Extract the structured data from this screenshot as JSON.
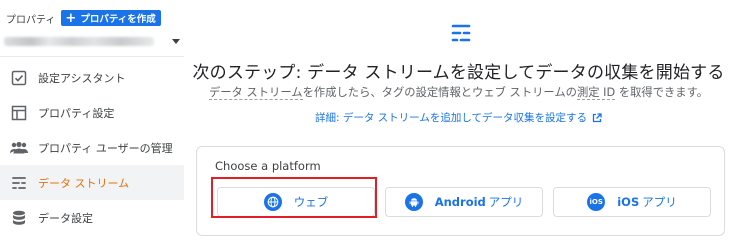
{
  "sidebar": {
    "property_label": "プロパティ",
    "create_button": "プロパティを作成",
    "items": [
      {
        "label": "設定アシスタント",
        "icon": "checklist-icon"
      },
      {
        "label": "プロパティ設定",
        "icon": "layout-icon"
      },
      {
        "label": "プロパティ ユーザーの管理",
        "icon": "people-icon"
      },
      {
        "label": "データ ストリーム",
        "icon": "stream-icon",
        "active": true
      },
      {
        "label": "データ設定",
        "icon": "database-icon"
      }
    ]
  },
  "main": {
    "headline": "次のステップ: データ ストリームを設定してデータの収集を開始する",
    "subline": {
      "part1": "データ ストリーム",
      "part2": "を作成したら、タグの設定情報とウェブ ストリームの",
      "part3": "測定 ID",
      "part4": " を取得できます。"
    },
    "learn_link": "詳細: データ ストリームを追加してデータ収集を設定する",
    "platform_card": {
      "title": "Choose a platform",
      "buttons": {
        "web": "ウェブ",
        "android_bold": "Android",
        "android_rest": "アプリ",
        "ios_bold": "iOS",
        "ios_rest": "アプリ"
      }
    }
  },
  "colors": {
    "accent": "#1a73e8",
    "active_nav": "#e8710a",
    "highlight": "#e31e24"
  }
}
